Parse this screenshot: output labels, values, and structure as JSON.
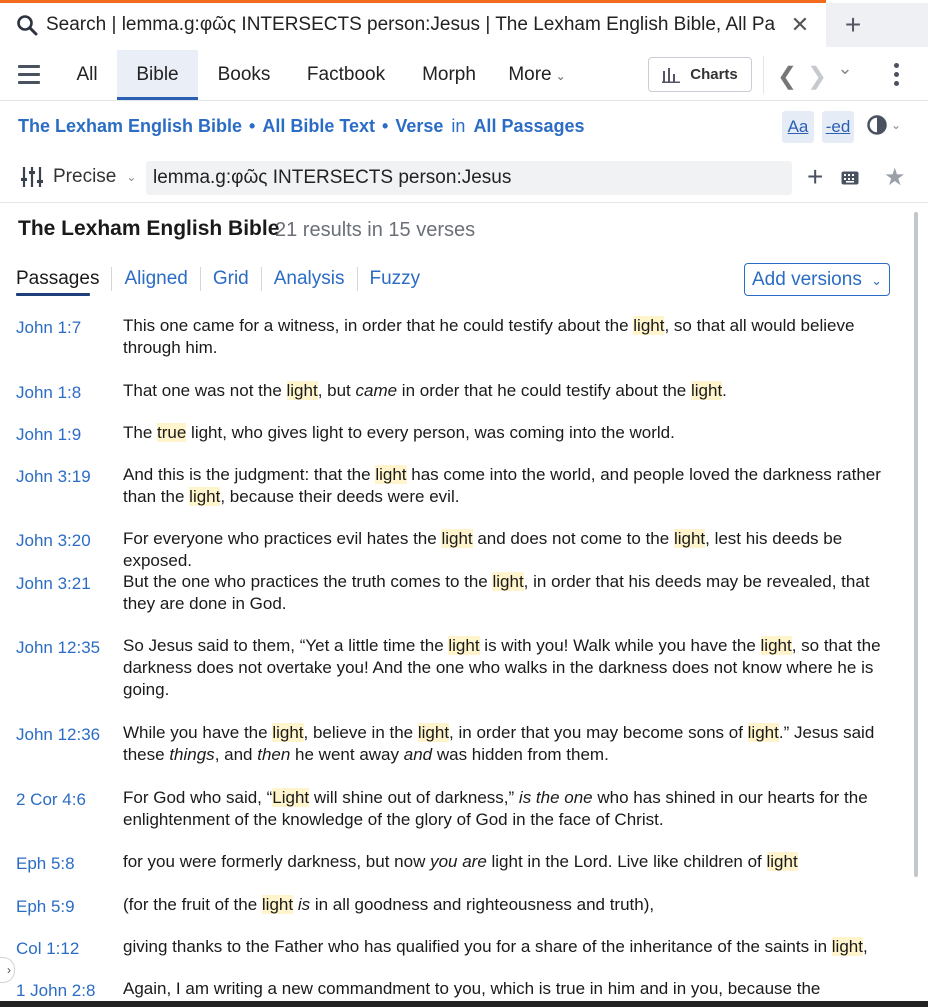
{
  "window": {
    "tab_title": "Search | lemma.g:φῶς INTERSECTS person:Jesus | The Lexham English Bible, All Passages",
    "close_glyph": "✕",
    "new_tab_glyph": "+"
  },
  "nav": {
    "tabs": [
      "All",
      "Bible",
      "Books",
      "Factbook",
      "Morph",
      "More"
    ],
    "active_tab": "Bible",
    "charts_label": "Charts",
    "back_glyph": "❮",
    "forward_glyph": "❯",
    "dropdown_glyph": "⌄"
  },
  "breadcrumb": {
    "resource": "The Lexham English Bible",
    "scope": "All Bible Text",
    "unit": "Verse",
    "in_word": "in",
    "range": "All Passages",
    "separator": "•"
  },
  "toolbar": {
    "font_button": "Aa",
    "ed_button": "-ed"
  },
  "query": {
    "mode": "Precise",
    "text": "lemma.g:φῶς INTERSECTS person:Jesus",
    "plus_glyph": "+",
    "star_glyph": "★"
  },
  "results": {
    "title": "The Lexham English Bible",
    "count": "21 results in 15 verses",
    "subtabs": [
      "Passages",
      "Aligned",
      "Grid",
      "Analysis",
      "Fuzzy"
    ],
    "active_subtab": "Passages",
    "add_versions": "Add versions"
  },
  "verses": [
    {
      "ref": "John 1:7",
      "html": "This one came for a witness, in order that he could testify about the <mark>light</mark>, so that all would believe through him."
    },
    {
      "ref": "John 1:8",
      "html": "That one was not the <mark>light</mark>, but <i>came</i> in order that he could testify about the <mark>light</mark>."
    },
    {
      "ref": "John 1:9",
      "html": "The <mark>true</mark> light, who gives light to every person, was coming into the world."
    },
    {
      "ref": "John 3:19",
      "html": "And this is the judgment: that the <mark>light</mark> has come into the world, and people loved the darkness rather than the <mark>light</mark>, because their deeds were evil."
    },
    {
      "ref": "John 3:20",
      "html": "For everyone who practices evil hates the <mark>light</mark> and does not come to the <mark>light</mark>, lest his deeds be exposed."
    },
    {
      "ref": "John 3:21",
      "html": "But the one who practices the truth comes to the <mark>light</mark>, in order that his deeds may be revealed, that they are done in God."
    },
    {
      "ref": "John 12:35",
      "html": "So Jesus said to them, “Yet a little time the <mark>light</mark> is with you! Walk while you have the <mark>light</mark>, so that the darkness does not overtake you! And the one who walks in the darkness does not know where he is going."
    },
    {
      "ref": "John 12:36",
      "html": "While you have the <mark>light</mark>, believe in the <mark>light</mark>, in order that you may become sons of <mark>light</mark>.” Jesus said these <i>things</i>, and <i>then</i> he went away <i>and</i> was hidden from them."
    },
    {
      "ref": "2 Cor 4:6",
      "html": "For God who said, “<mark>Light</mark> will shine out of darkness,” <i>is the one</i> who has shined in our hearts for the enlightenment of the knowledge of the glory of God in the face of Christ."
    },
    {
      "ref": "Eph 5:8",
      "html": "for you were formerly darkness, but now <i>you are</i> light in the Lord. Live like children of <mark>light</mark>"
    },
    {
      "ref": "Eph 5:9",
      "html": "(for the fruit of the <mark>light</mark> <i>is</i> in all goodness and righteousness and truth),"
    },
    {
      "ref": "Col 1:12",
      "html": "giving thanks to the Father who has qualified you for a share of the inheritance of the saints in <mark>light</mark>,"
    },
    {
      "ref": "1 John 2:8",
      "html": "Again, I am writing a new commandment to you, which is true in him and in you, because the darkness is"
    }
  ],
  "colors": {
    "accent": "#f26a1b",
    "link": "#2b6cc4",
    "highlight": "#fff4cc",
    "active_tab_bg": "#e9eef7"
  }
}
